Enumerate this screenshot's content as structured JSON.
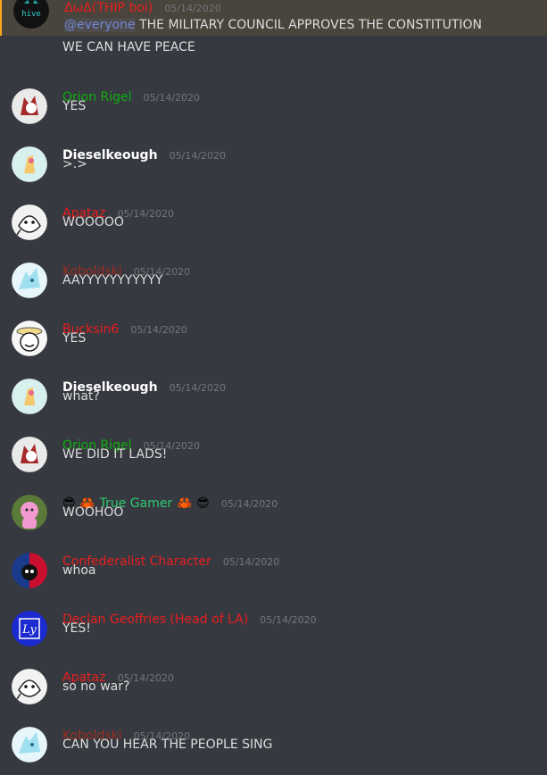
{
  "colors": {
    "background": "#36393f",
    "timestamp": "#72767d",
    "text": "#dcddde",
    "mention": "#7289da",
    "red_role": "#e91e1e",
    "dark_red_role": "#992d22",
    "green_role": "#11ae11",
    "white_name": "#ffffff",
    "bright_green": "#2ecc71"
  },
  "messages": [
    {
      "author": "ΔωΔ(THIP boi)",
      "timestamp": "05/14/2020",
      "mention": "@everyone",
      "content": "THE MILITARY COUNCIL APPROVES THE CONSTITUTION",
      "continuation": "WE CAN HAVE PEACE",
      "avatar": "hive-logo-avatar"
    },
    {
      "author": "Orion Rigel",
      "timestamp": "05/14/2020",
      "content": "YES",
      "avatar": "wolf-avatar"
    },
    {
      "author": "Dieselkeough",
      "timestamp": "05/14/2020",
      "content": ">.>",
      "avatar": "pony-avatar"
    },
    {
      "author": "Apataz",
      "timestamp": "05/14/2020",
      "content": "WOOOOO",
      "avatar": "ghost-avatar"
    },
    {
      "author": "Koboldski",
      "timestamp": "05/14/2020",
      "content": "AAYYYYYYYYYYY",
      "avatar": "dragon-avatar"
    },
    {
      "author": "Bucksin6",
      "timestamp": "05/14/2020",
      "content": "YES",
      "avatar": "hat-avatar"
    },
    {
      "author": "Dieselkeough",
      "timestamp": "05/14/2020",
      "content": "what?",
      "avatar": "pony-avatar"
    },
    {
      "author": "Orion Rigel",
      "timestamp": "05/14/2020",
      "content": "WE DID IT LADS!",
      "avatar": "wolf-avatar"
    },
    {
      "author": "True Gamer",
      "prefix_emoji": "😎 🦀",
      "suffix_emoji": "🦀 😎",
      "timestamp": "05/14/2020",
      "content": "WOOHOO",
      "avatar": "pink-avatar"
    },
    {
      "author": "Confederalist Character",
      "timestamp": "05/14/2020",
      "content": "whoa",
      "avatar": "flag-ball-avatar"
    },
    {
      "author": "Declan Geoffries (Head of LA)",
      "timestamp": "05/14/2020",
      "content": "YES!",
      "avatar": "ly-avatar"
    },
    {
      "author": "Apataz",
      "timestamp": "05/14/2020",
      "content": "so no war?",
      "avatar": "ghost-avatar"
    },
    {
      "author": "Koboldski",
      "timestamp": "05/14/2020",
      "content": "CAN YOU HEAR THE PEOPLE SING",
      "avatar": "dragon-avatar"
    }
  ]
}
